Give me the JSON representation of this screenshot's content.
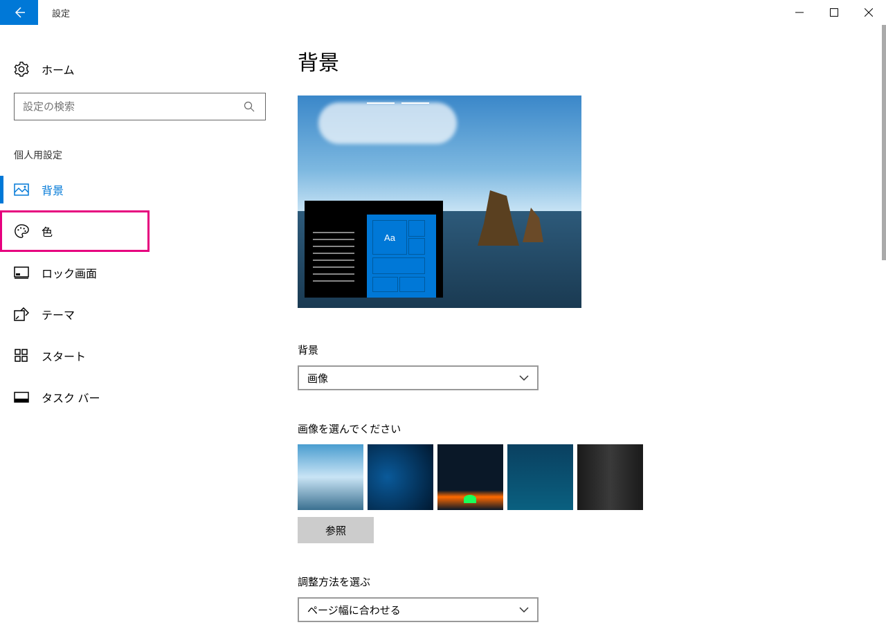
{
  "window": {
    "title": "設定"
  },
  "sidebar": {
    "home": "ホーム",
    "search_placeholder": "設定の検索",
    "category": "個人用設定",
    "items": [
      {
        "label": "背景"
      },
      {
        "label": "色"
      },
      {
        "label": "ロック画面"
      },
      {
        "label": "テーマ"
      },
      {
        "label": "スタート"
      },
      {
        "label": "タスク バー"
      }
    ]
  },
  "main": {
    "title": "背景",
    "preview_tile_text": "Aa",
    "bg_label": "背景",
    "bg_value": "画像",
    "choose_label": "画像を選んでください",
    "browse": "参照",
    "fit_label": "調整方法を選ぶ",
    "fit_value": "ページ幅に合わせる"
  }
}
